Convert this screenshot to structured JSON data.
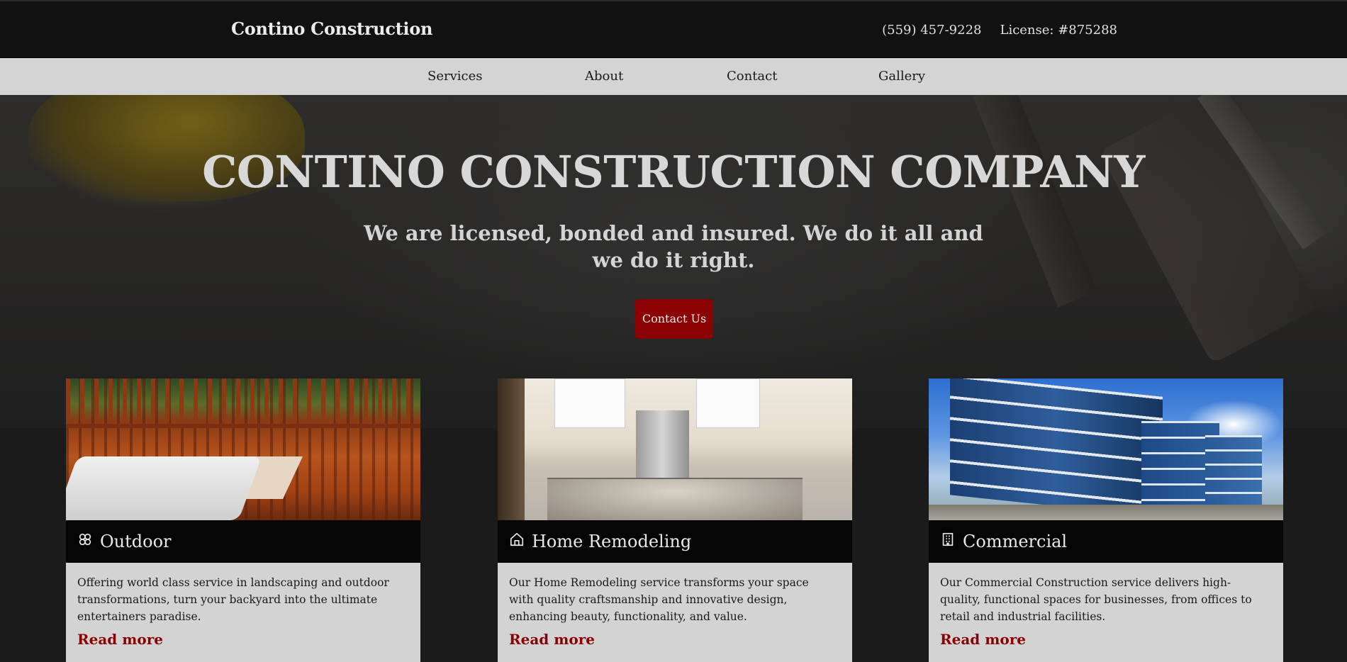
{
  "header": {
    "brand": "Contino Construction",
    "phone": "(559) 457-9228",
    "license": "License: #875288"
  },
  "nav": {
    "items": [
      {
        "label": "Services"
      },
      {
        "label": "About"
      },
      {
        "label": "Contact"
      },
      {
        "label": "Gallery"
      }
    ]
  },
  "hero": {
    "title": "CONTINO CONSTRUCTION COMPANY",
    "subtitle": "We are licensed, bonded and insured. We do it all and we do it right.",
    "cta_label": "Contact Us"
  },
  "cards": [
    {
      "icon": "flower-icon",
      "title": "Outdoor",
      "text": "Offering world class service in landscaping and outdoor transformations, turn your backyard into the ultimate entertainers paradise.",
      "link": "Read more"
    },
    {
      "icon": "home-icon",
      "title": "Home Remodeling",
      "text": "Our Home Remodeling service transforms your space with quality craftsmanship and innovative design, enhancing beauty, functionality, and value.",
      "link": "Read more"
    },
    {
      "icon": "building-icon",
      "title": "Commercial",
      "text": "Our Commercial Construction service delivers high-quality, functional spaces for businesses, from offices to retail and industrial facilities.",
      "link": "Read more"
    }
  ],
  "colors": {
    "accent": "#8b0000",
    "header_bg": "#111111",
    "nav_bg": "#d4d4d4",
    "card_bg": "#d3d3d3"
  }
}
